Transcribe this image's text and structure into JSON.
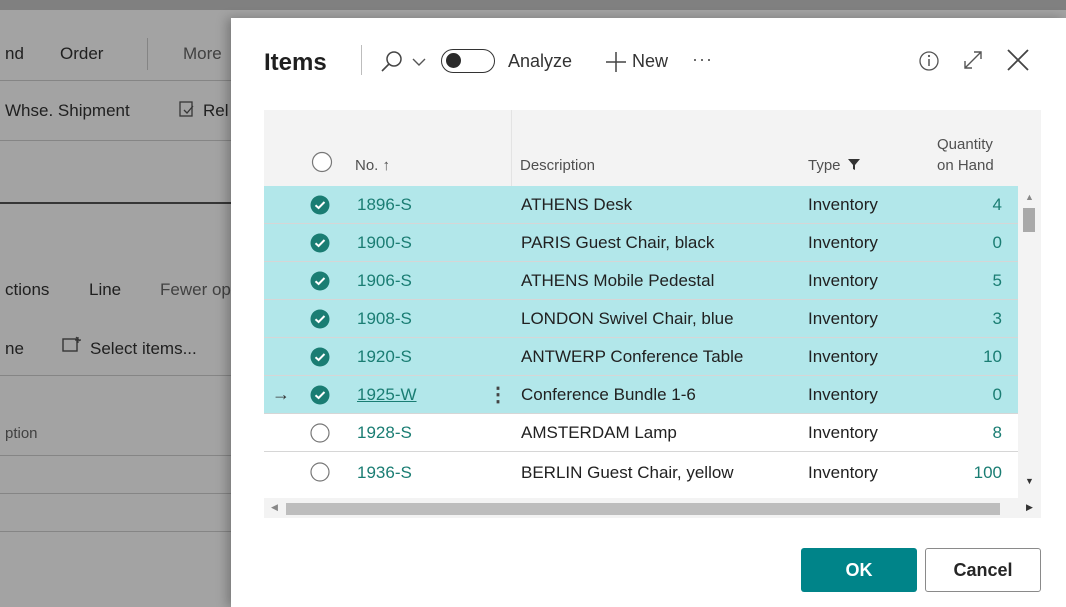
{
  "background": {
    "menu": [
      "nd",
      "Order",
      "More"
    ],
    "actions": [
      "Whse. Shipment",
      "Rel"
    ],
    "line_tabs": [
      "ctions",
      "Line",
      "Fewer op"
    ],
    "line_actions": [
      "ne",
      "Select items..."
    ],
    "column_label": "ption"
  },
  "dialog": {
    "title": "Items",
    "analyze_label": "Analyze",
    "new_label": "New",
    "more_label": "···",
    "columns": {
      "no": "No. ↑",
      "description": "Description",
      "type": "Type",
      "qty_line1": "Quantity",
      "qty_line2": "on Hand"
    },
    "rows": [
      {
        "no": "1896-S",
        "description": "ATHENS Desk",
        "type": "Inventory",
        "qty": "4",
        "selected": true
      },
      {
        "no": "1900-S",
        "description": "PARIS Guest Chair, black",
        "type": "Inventory",
        "qty": "0",
        "selected": true
      },
      {
        "no": "1906-S",
        "description": "ATHENS Mobile Pedestal",
        "type": "Inventory",
        "qty": "5",
        "selected": true
      },
      {
        "no": "1908-S",
        "description": "LONDON Swivel Chair, blue",
        "type": "Inventory",
        "qty": "3",
        "selected": true
      },
      {
        "no": "1920-S",
        "description": "ANTWERP Conference Table",
        "type": "Inventory",
        "qty": "10",
        "selected": true
      },
      {
        "no": "1925-W",
        "description": "Conference Bundle 1-6",
        "type": "Inventory",
        "qty": "0",
        "selected": true,
        "current": true
      },
      {
        "no": "1928-S",
        "description": "AMSTERDAM Lamp",
        "type": "Inventory",
        "qty": "8",
        "selected": false
      },
      {
        "no": "1936-S",
        "description": "BERLIN Guest Chair, yellow",
        "type": "Inventory",
        "qty": "100",
        "selected": false
      }
    ],
    "ok_label": "OK",
    "cancel_label": "Cancel"
  },
  "colors": {
    "accent": "#008489",
    "selected_row": "#b2e7ea",
    "link": "#1a7d73"
  }
}
